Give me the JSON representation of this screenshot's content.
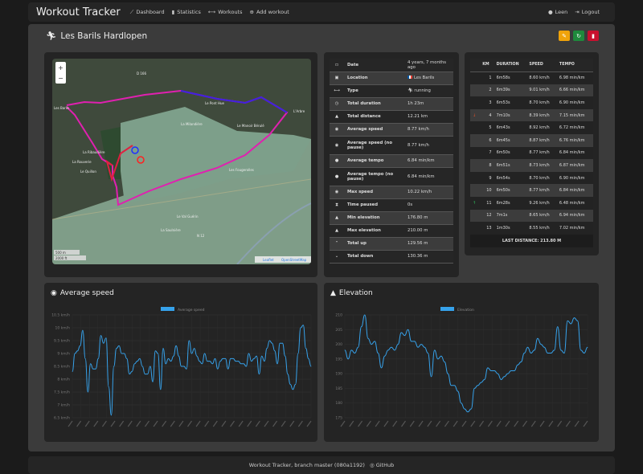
{
  "navbar": {
    "brand": "Workout Tracker",
    "links": [
      {
        "label": "Dashboard",
        "icon": "chart-line-icon"
      },
      {
        "label": "Statistics",
        "icon": "bar-chart-icon"
      },
      {
        "label": "Workouts",
        "icon": "dumbbell-icon"
      },
      {
        "label": "Add workout",
        "icon": "plus-circle-icon"
      }
    ],
    "user": "Leen",
    "logout": "Logout"
  },
  "workout": {
    "title": "Les Barils Hardlopen",
    "actions": [
      {
        "name": "edit",
        "color": "#f0a30a"
      },
      {
        "name": "refresh",
        "color": "#1e8a3c"
      },
      {
        "name": "delete",
        "color": "#c8102e"
      }
    ]
  },
  "map": {
    "zoom_in": "+",
    "zoom_out": "−",
    "scale_m": "500 m",
    "scale_ft": "2000 ft",
    "attribution_leaflet": "Leaflet",
    "attribution_osm": "OpenStreetMap",
    "places": [
      "D 166",
      "Les Barils",
      "Le Pont Hue",
      "La Milandière",
      "Le Manoir Bérulé",
      "L'Arbre",
      "La Ribaudière",
      "La Rouverie",
      "Le Quillon",
      "Les Fougerolles",
      "Le Val Guérin",
      "La Saulnière",
      "N 12"
    ]
  },
  "stats": [
    {
      "icon": "calendar-icon",
      "label": "Date",
      "value": "4 years, 7 months ago"
    },
    {
      "icon": "map-pin-icon",
      "label": "Location",
      "value": "Les Barils",
      "flag": true
    },
    {
      "icon": "dumbbell-icon",
      "label": "Type",
      "value": "running"
    },
    {
      "icon": "clock-icon",
      "label": "Total duration",
      "value": "1h 23m"
    },
    {
      "icon": "road-icon",
      "label": "Total distance",
      "value": "12.21 km"
    },
    {
      "icon": "speedometer-icon",
      "label": "Average speed",
      "value": "8.77 km/h"
    },
    {
      "icon": "speedometer-icon",
      "label": "Average speed (no pause)",
      "value": "8.77 km/h"
    },
    {
      "icon": "stopwatch-icon",
      "label": "Average tempo",
      "value": "6.84 min/km"
    },
    {
      "icon": "stopwatch-icon",
      "label": "Average tempo (no pause)",
      "value": "6.84 min/km"
    },
    {
      "icon": "gauge-icon",
      "label": "Max speed",
      "value": "10.22 km/h"
    },
    {
      "icon": "hourglass-icon",
      "label": "Time paused",
      "value": "0s"
    },
    {
      "icon": "mountain-icon",
      "label": "Min elevation",
      "value": "176.80 m"
    },
    {
      "icon": "mountain-icon",
      "label": "Max elevation",
      "value": "210.00 m"
    },
    {
      "icon": "chevron-up-icon",
      "label": "Total up",
      "value": "129.56 m"
    },
    {
      "icon": "chevron-down-icon",
      "label": "Total down",
      "value": "130.36 m"
    }
  ],
  "laps": {
    "headers": [
      "KM",
      "DURATION",
      "SPEED",
      "TEMPO"
    ],
    "rows": [
      {
        "km": "1",
        "duration": "6m58s",
        "speed": "8.60 km/h",
        "tempo": "6.98 min/km"
      },
      {
        "km": "2",
        "duration": "6m39s",
        "speed": "9.01 km/h",
        "tempo": "6.66 min/km"
      },
      {
        "km": "3",
        "duration": "6m53s",
        "speed": "8.70 km/h",
        "tempo": "6.90 min/km"
      },
      {
        "km": "4",
        "duration": "7m10s",
        "speed": "8.39 km/h",
        "tempo": "7.15 min/km",
        "marker": "slowest"
      },
      {
        "km": "5",
        "duration": "6m43s",
        "speed": "8.92 km/h",
        "tempo": "6.72 min/km"
      },
      {
        "km": "6",
        "duration": "6m45s",
        "speed": "8.87 km/h",
        "tempo": "6.76 min/km"
      },
      {
        "km": "7",
        "duration": "6m50s",
        "speed": "8.77 km/h",
        "tempo": "6.84 min/km"
      },
      {
        "km": "8",
        "duration": "6m51s",
        "speed": "8.73 km/h",
        "tempo": "6.87 min/km"
      },
      {
        "km": "9",
        "duration": "6m54s",
        "speed": "8.70 km/h",
        "tempo": "6.90 min/km"
      },
      {
        "km": "10",
        "duration": "6m50s",
        "speed": "8.77 km/h",
        "tempo": "6.84 min/km"
      },
      {
        "km": "11",
        "duration": "6m28s",
        "speed": "9.26 km/h",
        "tempo": "6.48 min/km",
        "marker": "fastest"
      },
      {
        "km": "12",
        "duration": "7m1s",
        "speed": "8.65 km/h",
        "tempo": "6.94 min/km"
      },
      {
        "km": "13",
        "duration": "1m30s",
        "speed": "8.55 km/h",
        "tempo": "7.02 min/km"
      }
    ],
    "footer": "LAST DISTANCE: 213.80 M"
  },
  "chart_data": [
    {
      "type": "line",
      "title": "Average speed",
      "legend": "Average speed",
      "legend_position": "top",
      "color": "#36a2eb",
      "grid": true,
      "ylim": [
        6.5,
        10.5
      ],
      "yticks": [
        "10.5 km/h",
        "10 km/h",
        "9.5 km/h",
        "9 km/h",
        "8.5 km/h",
        "8 km/h",
        "7.5 km/h",
        "7 km/h",
        "6.5 km/h"
      ],
      "values": [
        8.3,
        9.0,
        9.1,
        9.3,
        9.9,
        8.8,
        7.5,
        8.6,
        8.4,
        8.4,
        8.8,
        9.7,
        9.4,
        9.6,
        7.7,
        6.6,
        8.5,
        9.2,
        9.3,
        9.0,
        9.0,
        8.8,
        8.2,
        8.3,
        8.6,
        8.7,
        8.8,
        8.5,
        8.2,
        8.2,
        8.5,
        7.9,
        9.1,
        9.0,
        7.6,
        9.2,
        8.6,
        8.8,
        8.7,
        8.9,
        9.3,
        8.9,
        8.5,
        8.5,
        8.4,
        9.5,
        9.0,
        9.2,
        8.9,
        8.7,
        8.6,
        9.0,
        8.7,
        8.7,
        8.6,
        8.8,
        8.4,
        8.7,
        8.8,
        8.8,
        8.4,
        8.8,
        8.8,
        8.7,
        8.7,
        8.6,
        8.6,
        8.5,
        9.0,
        8.7,
        8.8,
        8.9,
        8.2,
        8.9,
        8.7,
        9.2,
        9.5,
        9.4,
        9.1,
        8.6,
        9.4,
        9.4,
        8.9,
        8.2,
        7.8,
        7.6,
        7.8,
        9.0,
        10.0,
        10.1,
        9.2,
        8.8,
        8.5
      ]
    },
    {
      "type": "line",
      "title": "Elevation",
      "legend": "Elevation",
      "legend_position": "top",
      "color": "#36a2eb",
      "grid": true,
      "ylim": [
        175,
        210
      ],
      "yticks": [
        "210",
        "205",
        "200",
        "195",
        "190",
        "185",
        "180",
        "175"
      ],
      "values": [
        198,
        195,
        198,
        197,
        199,
        206,
        210,
        202,
        200,
        201,
        197,
        192,
        196,
        198,
        199,
        198,
        200,
        204,
        203,
        205,
        201,
        201,
        199,
        200,
        199,
        197,
        189,
        198,
        195,
        196,
        194,
        190,
        186,
        186,
        184,
        180,
        178,
        177,
        178,
        185,
        186,
        187,
        188,
        192,
        191,
        191,
        190,
        188,
        189,
        190,
        191,
        191,
        193,
        194,
        197,
        199,
        197,
        198,
        202,
        200,
        199,
        197,
        197,
        198,
        206,
        198,
        197,
        208,
        207,
        209,
        208,
        198,
        197,
        199
      ]
    }
  ],
  "footer": {
    "text": "Workout Tracker, branch master (080a1192)",
    "github": "GitHub"
  }
}
